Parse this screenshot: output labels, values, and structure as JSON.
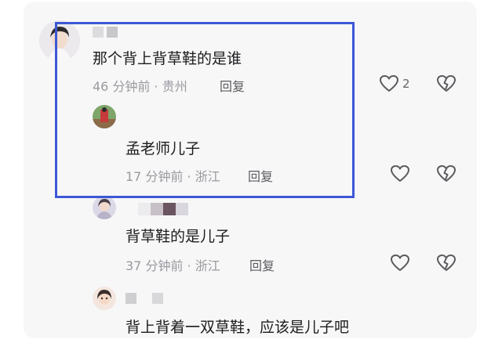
{
  "comments": [
    {
      "id": "c1",
      "text": "那个背上背草鞋的是谁",
      "time": "46 分钟前",
      "location": "贵州",
      "reply_label": "回复",
      "like_count": "2"
    },
    {
      "id": "c2",
      "text": "孟老师儿子",
      "time": "17 分钟前",
      "location": "浙江",
      "reply_label": "回复"
    },
    {
      "id": "c3",
      "text": "背草鞋的是儿子",
      "time": "37 分钟前",
      "location": "浙江",
      "reply_label": "回复"
    },
    {
      "id": "c4",
      "text": "背上背着一双草鞋，应该是儿子吧"
    }
  ],
  "separator": "·",
  "colors": {
    "highlight_border": "#3c58d7",
    "card_background": "#f7f7f8",
    "meta_text": "#9a9a9f"
  },
  "icons": [
    "heart-icon",
    "broken-heart-icon"
  ]
}
